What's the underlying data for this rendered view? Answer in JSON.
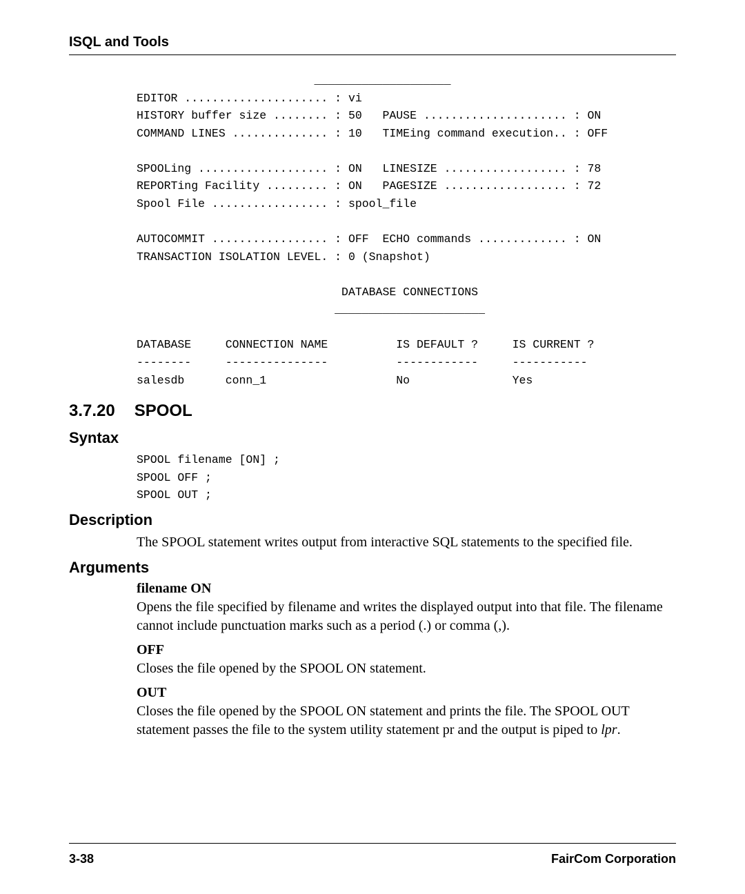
{
  "header": "ISQL and Tools",
  "code1": "                          ____________________\nEDITOR ..................... : vi\nHISTORY buffer size ........ : 50   PAUSE ..................... : ON\nCOMMAND LINES .............. : 10   TIMEing command execution.. : OFF\n\nSPOOLing ................... : ON   LINESIZE .................. : 78\nREPORTing Facility ......... : ON   PAGESIZE .................. : 72\nSpool File ................. : spool_file\n\nAUTOCOMMIT ................. : OFF  ECHO commands ............. : ON\nTRANSACTION ISOLATION LEVEL. : 0 (Snapshot)\n\n                              DATABASE CONNECTIONS\n                             ______________________\n\nDATABASE     CONNECTION NAME          IS DEFAULT ?     IS CURRENT ?\n--------     ---------------          ------------     -----------\nsalesdb      conn_1                   No               Yes",
  "section": {
    "num": "3.7.20",
    "title": "SPOOL"
  },
  "syntax_heading": "Syntax",
  "syntax_code": "SPOOL filename [ON] ;\nSPOOL OFF ;\nSPOOL OUT ;",
  "description_heading": "Description",
  "description_text": "The SPOOL statement writes output from interactive SQL statements to the specified file.",
  "arguments_heading": "Arguments",
  "args": {
    "a1_head": "filename ON",
    "a1_text": "Opens the file specified by filename and writes the displayed output into that file. The filename cannot include punctuation marks such as a period (.) or comma (,).",
    "a2_head": "OFF",
    "a2_text": "Closes the file opened by the SPOOL ON statement.",
    "a3_head": "OUT",
    "a3_text_pre": "Closes the file opened by the SPOOL ON statement and prints the file. The SPOOL OUT statement passes the file to the system utility statement pr and the output is piped to ",
    "a3_text_it": "lpr",
    "a3_text_post": "."
  },
  "footer": {
    "left": "3-38",
    "right": "FairCom Corporation"
  }
}
